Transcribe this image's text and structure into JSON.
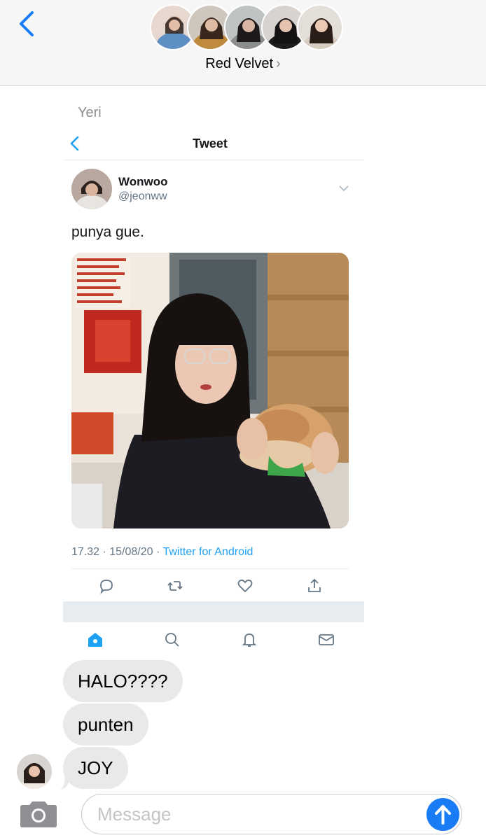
{
  "header": {
    "group_name": "Red Velvet",
    "chevron": "›",
    "member_avatars": [
      "member-1",
      "member-2",
      "member-3",
      "member-4",
      "member-5"
    ]
  },
  "conversation": {
    "sender_label": "Yeri",
    "tweet": {
      "screen_title": "Tweet",
      "author_name": "Wonwoo",
      "author_handle": "@jeonww",
      "text": "punya gue.",
      "timestamp": "17.32 · 15/08/20 · ",
      "source": "Twitter for Android",
      "actions": [
        "reply-icon",
        "retweet-icon",
        "like-icon",
        "share-icon"
      ],
      "nav": [
        "home-icon",
        "search-icon",
        "notifications-icon",
        "messages-icon"
      ],
      "accent_color": "#1da1f2"
    },
    "bubbles": [
      "HALO????",
      "punten",
      "JOY"
    ]
  },
  "composer": {
    "placeholder": "Message",
    "send_color": "#1a7cf5"
  }
}
